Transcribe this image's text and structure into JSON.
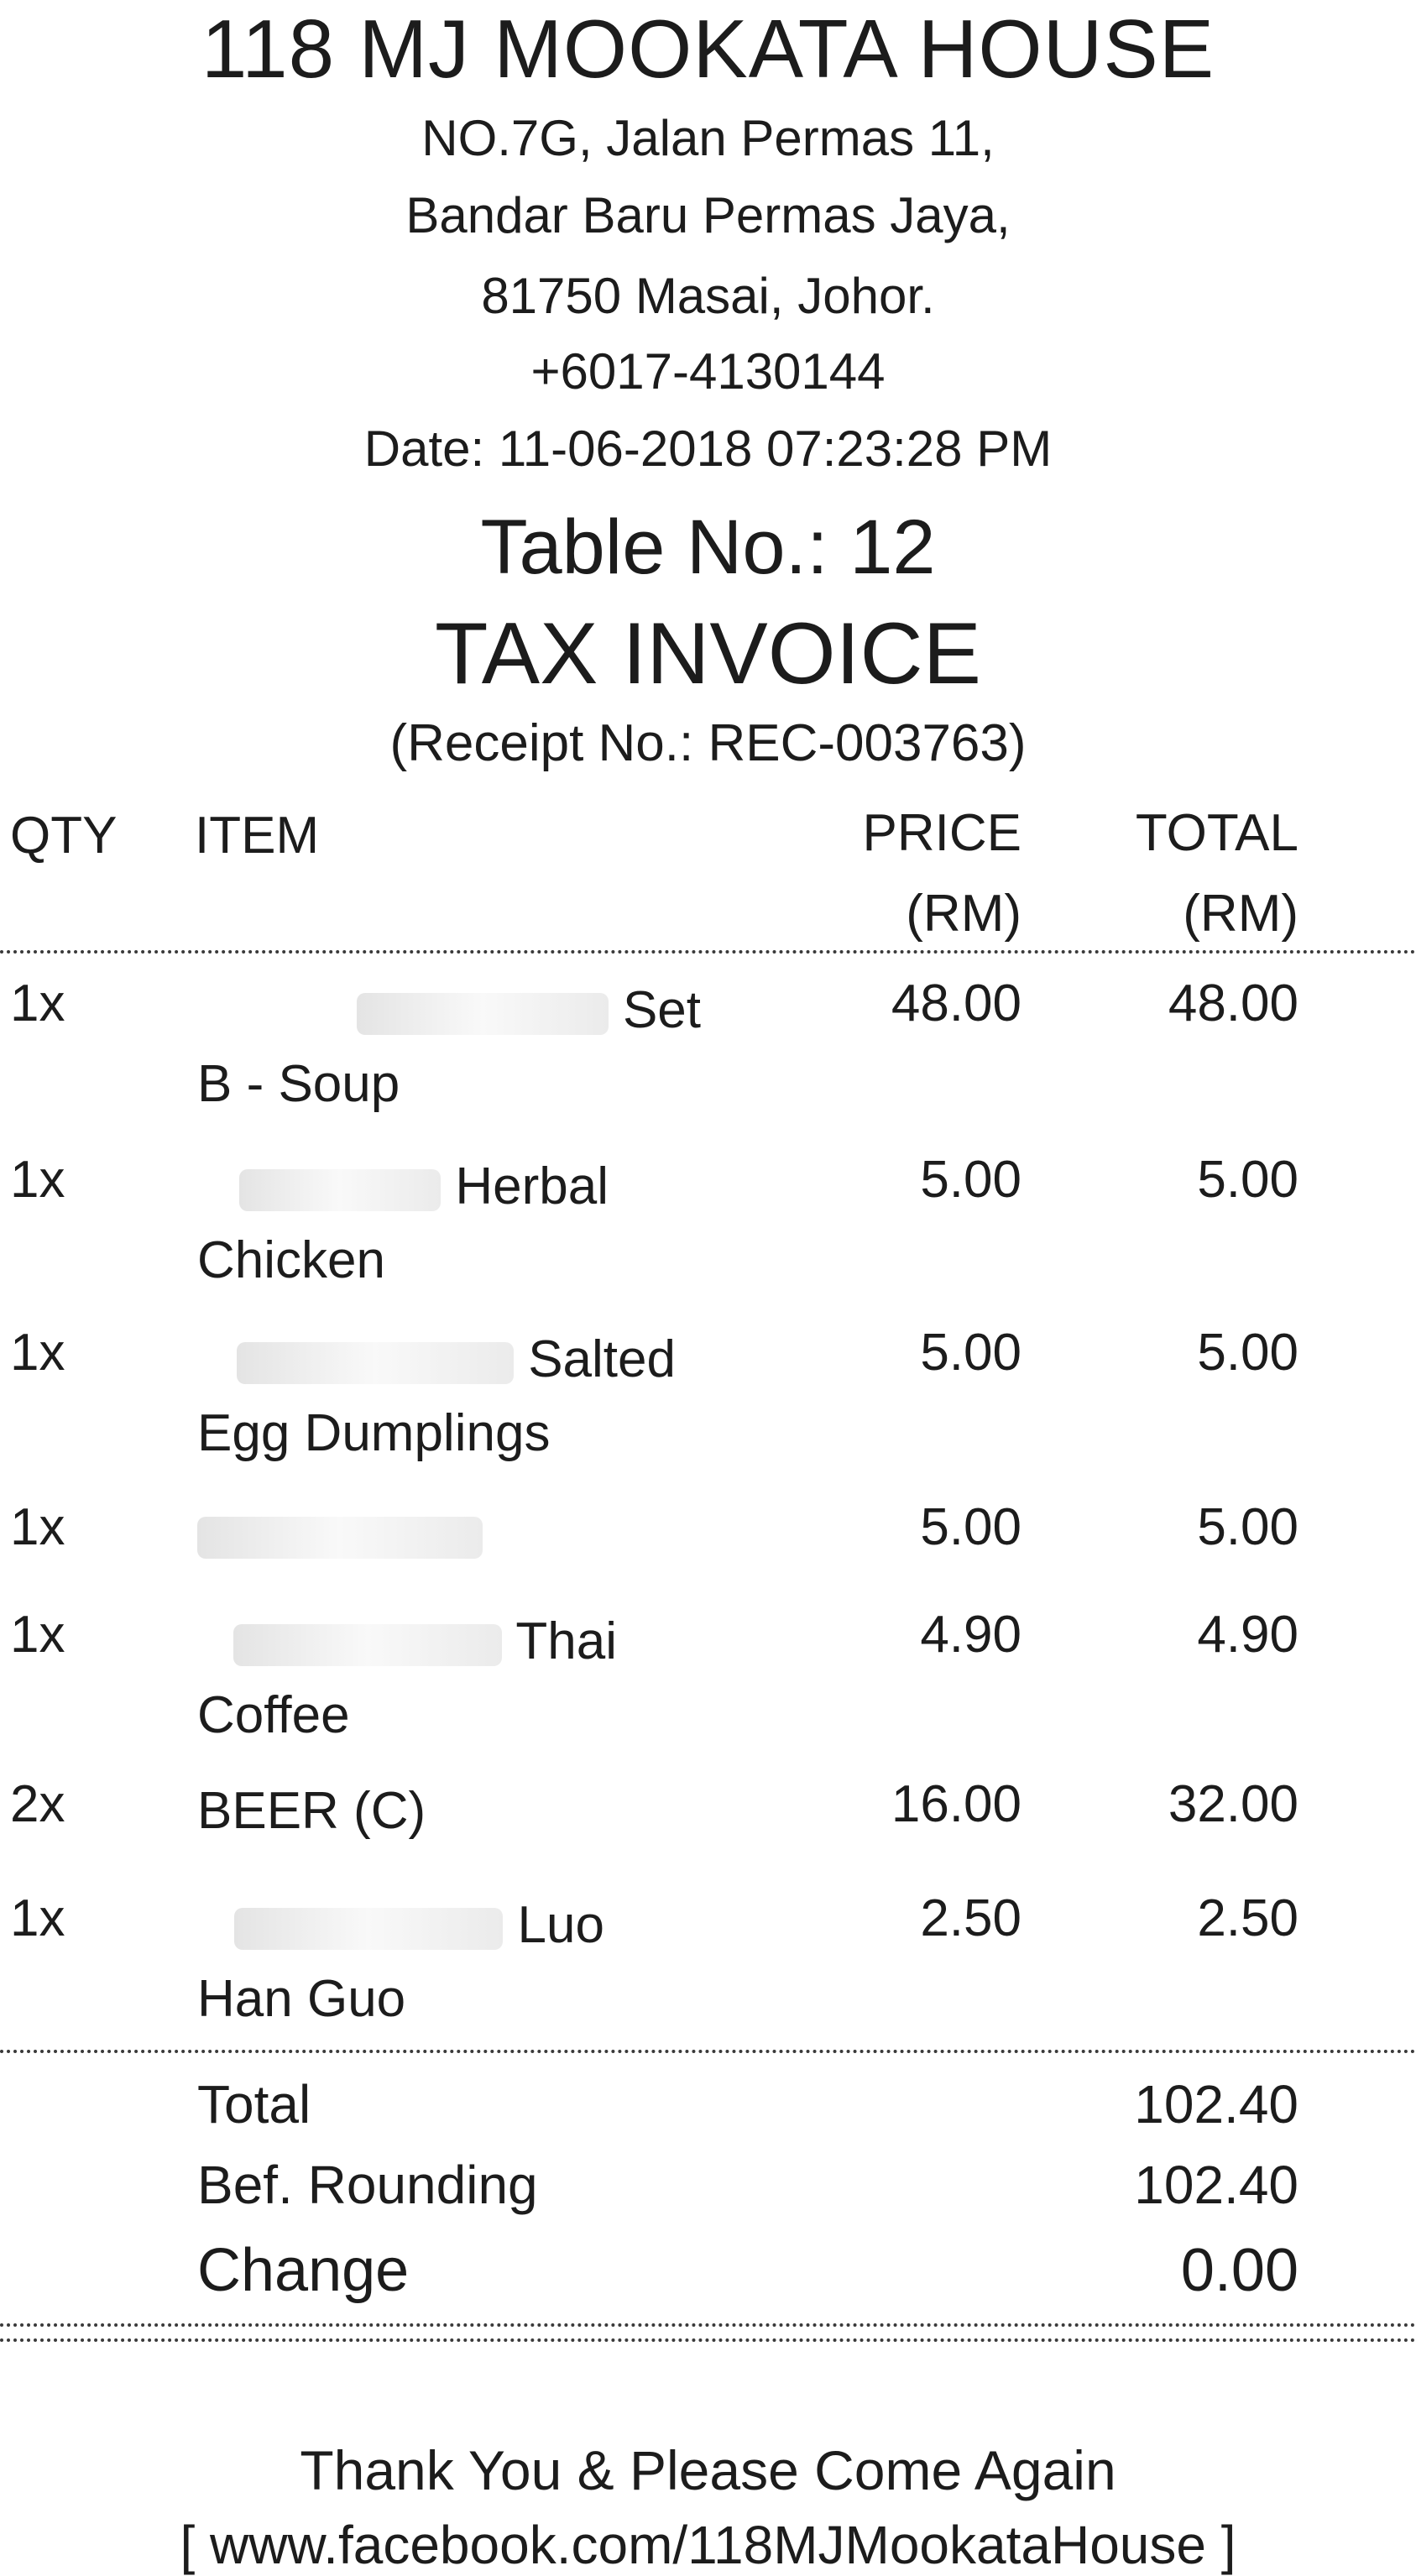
{
  "header": {
    "store_name": "118 MJ MOOKATA HOUSE",
    "address_line1": "NO.7G, Jalan Permas 11,",
    "address_line2": "Bandar Baru Permas Jaya,",
    "address_line3": "81750 Masai, Johor.",
    "phone": "+6017-4130144",
    "date": "Date: 11-06-2018 07:23:28 PM",
    "table_no": "Table No.: 12",
    "invoice_title": "TAX INVOICE",
    "receipt_no": "(Receipt No.: REC-003763)"
  },
  "columns": {
    "qty": "QTY",
    "item": "ITEM",
    "price_line1": "PRICE",
    "price_line2": "(RM)",
    "total_line1": "TOTAL",
    "total_line2": "(RM)"
  },
  "items": [
    {
      "qty": "1x",
      "name_line1": "Set",
      "name_line2": "B - Soup",
      "price": "48.00",
      "total": "48.00"
    },
    {
      "qty": "1x",
      "name_line1": "Herbal",
      "name_line2": "Chicken",
      "price": "5.00",
      "total": "5.00"
    },
    {
      "qty": "1x",
      "name_line1": "Salted",
      "name_line2": "Egg Dumplings",
      "price": "5.00",
      "total": "5.00"
    },
    {
      "qty": "1x",
      "name_line1": "",
      "name_line2": "",
      "price": "5.00",
      "total": "5.00"
    },
    {
      "qty": "1x",
      "name_line1": "Thai",
      "name_line2": "Coffee",
      "price": "4.90",
      "total": "4.90"
    },
    {
      "qty": "2x",
      "name_line1": "BEER (C)",
      "name_line2": "",
      "price": "16.00",
      "total": "32.00"
    },
    {
      "qty": "1x",
      "name_line1": "Luo",
      "name_line2": "Han Guo",
      "price": "2.50",
      "total": "2.50"
    }
  ],
  "summary": {
    "total_label": "Total",
    "total_value": "102.40",
    "before_rounding_label": "Bef. Rounding",
    "before_rounding_value": "102.40",
    "change_label": "Change",
    "change_value": "0.00"
  },
  "footer": {
    "thanks": "Thank You & Please Come Again",
    "facebook": "[ www.facebook.com/118MJMookataHouse ]"
  }
}
